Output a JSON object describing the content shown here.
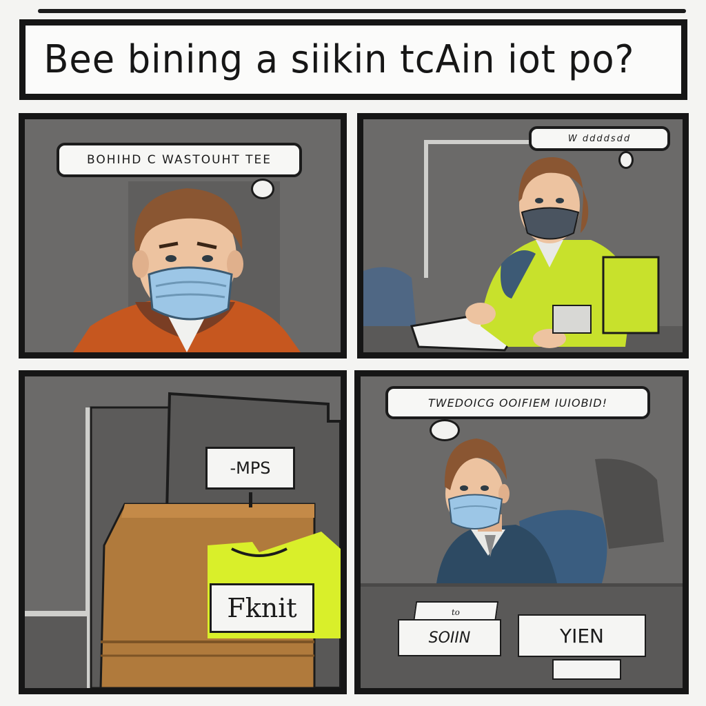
{
  "title": "Bee bining a siikin tcAin iot po?",
  "panels": [
    {
      "bubble_text": "BOHIHD C WASTOUHT TEE"
    },
    {
      "bubble_text": "W ddddsdd"
    },
    {
      "sign_text": "-MPS",
      "box_label": "Fknit"
    },
    {
      "bubble_text": "TWEDOICG OOIFIEM IUIOBID!",
      "paper_left": "SOIIN",
      "paper_left_top": "to",
      "paper_right": "YIEN"
    }
  ],
  "colors": {
    "frame": "#161616",
    "panel_bg": "#6b6a69",
    "mask": "#9cc6e6",
    "jacket_orange": "#c6571f",
    "vest_yellow": "#c8e12c",
    "suit_blue": "#2d4a63",
    "box_brown": "#b07a3c"
  }
}
